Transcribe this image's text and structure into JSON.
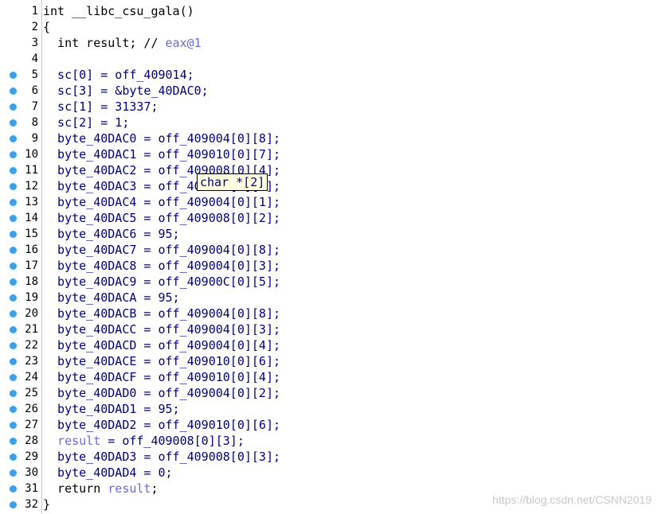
{
  "lines": [
    {
      "n": "1",
      "dot": false,
      "segs": [
        {
          "t": "int __libc_csu_gala()",
          "c": "kw"
        }
      ]
    },
    {
      "n": "2",
      "dot": false,
      "segs": [
        {
          "t": "{",
          "c": "kw"
        }
      ]
    },
    {
      "n": "3",
      "dot": false,
      "segs": [
        {
          "t": "  int result; // ",
          "c": "kw"
        },
        {
          "t": "eax@1",
          "c": "ital"
        }
      ]
    },
    {
      "n": "4",
      "dot": false,
      "segs": []
    },
    {
      "n": "5",
      "dot": true,
      "segs": [
        {
          "t": "  sc[0] = off_409014;",
          "c": "ident"
        }
      ]
    },
    {
      "n": "6",
      "dot": true,
      "segs": [
        {
          "t": "  sc[3] = &byte_40DAC0;",
          "c": "ident"
        }
      ]
    },
    {
      "n": "7",
      "dot": true,
      "segs": [
        {
          "t": "  sc[1] = 31337;",
          "c": "ident"
        }
      ]
    },
    {
      "n": "8",
      "dot": true,
      "segs": [
        {
          "t": "  sc[2] = 1;",
          "c": "ident"
        }
      ]
    },
    {
      "n": "9",
      "dot": true,
      "segs": [
        {
          "t": "  byte_40DAC0 = off_409004[0][8];",
          "c": "ident"
        }
      ]
    },
    {
      "n": "10",
      "dot": true,
      "segs": [
        {
          "t": "  byte_40DAC1 = off_409010[0][7];",
          "c": "ident"
        }
      ]
    },
    {
      "n": "11",
      "dot": true,
      "segs": [
        {
          "t": "  byte_40DAC2 = off_409008[0][4];",
          "c": "ident"
        }
      ]
    },
    {
      "n": "12",
      "dot": true,
      "segs": [
        {
          "t": "  byte_40DAC3 = off_40900C[0][6];",
          "c": "ident"
        }
      ]
    },
    {
      "n": "13",
      "dot": true,
      "segs": [
        {
          "t": "  byte_40DAC4 = off_409004[0][1];",
          "c": "ident"
        }
      ]
    },
    {
      "n": "14",
      "dot": true,
      "segs": [
        {
          "t": "  byte_40DAC5 = off_409008[0][2];",
          "c": "ident"
        }
      ]
    },
    {
      "n": "15",
      "dot": true,
      "segs": [
        {
          "t": "  byte_40DAC6 = 95;",
          "c": "ident"
        }
      ]
    },
    {
      "n": "16",
      "dot": true,
      "segs": [
        {
          "t": "  byte_40DAC7 = off_409004[0][8];",
          "c": "ident"
        }
      ]
    },
    {
      "n": "17",
      "dot": true,
      "segs": [
        {
          "t": "  byte_40DAC8 = off_409004[0][3];",
          "c": "ident"
        }
      ]
    },
    {
      "n": "18",
      "dot": true,
      "segs": [
        {
          "t": "  byte_40DAC9 = off_40900C[0][5];",
          "c": "ident"
        }
      ]
    },
    {
      "n": "19",
      "dot": true,
      "segs": [
        {
          "t": "  byte_40DACA = 95;",
          "c": "ident"
        }
      ]
    },
    {
      "n": "20",
      "dot": true,
      "segs": [
        {
          "t": "  byte_40DACB = off_409004[0][8];",
          "c": "ident"
        }
      ]
    },
    {
      "n": "21",
      "dot": true,
      "segs": [
        {
          "t": "  byte_40DACC = off_409004[0][3];",
          "c": "ident"
        }
      ]
    },
    {
      "n": "22",
      "dot": true,
      "segs": [
        {
          "t": "  byte_40DACD = off_409004[0][4];",
          "c": "ident"
        }
      ]
    },
    {
      "n": "23",
      "dot": true,
      "segs": [
        {
          "t": "  byte_40DACE = off_409010[0][6];",
          "c": "ident"
        }
      ]
    },
    {
      "n": "24",
      "dot": true,
      "segs": [
        {
          "t": "  byte_40DACF = off_409010[0][4];",
          "c": "ident"
        }
      ]
    },
    {
      "n": "25",
      "dot": true,
      "segs": [
        {
          "t": "  byte_40DAD0 = off_409004[0][2];",
          "c": "ident"
        }
      ]
    },
    {
      "n": "26",
      "dot": true,
      "segs": [
        {
          "t": "  byte_40DAD1 = 95;",
          "c": "ident"
        }
      ]
    },
    {
      "n": "27",
      "dot": true,
      "segs": [
        {
          "t": "  byte_40DAD2 = off_409010[0][6];",
          "c": "ident"
        }
      ]
    },
    {
      "n": "28",
      "dot": true,
      "segs": [
        {
          "t": "  ",
          "c": "ident"
        },
        {
          "t": "result",
          "c": "ital"
        },
        {
          "t": " = off_409008[0][3];",
          "c": "ident"
        }
      ]
    },
    {
      "n": "29",
      "dot": true,
      "segs": [
        {
          "t": "  byte_40DAD3 = off_409008[0][3];",
          "c": "ident"
        }
      ]
    },
    {
      "n": "30",
      "dot": true,
      "segs": [
        {
          "t": "  byte_40DAD4 = 0;",
          "c": "ident"
        }
      ]
    },
    {
      "n": "31",
      "dot": true,
      "segs": [
        {
          "t": "  return ",
          "c": "kw"
        },
        {
          "t": "result",
          "c": "ital"
        },
        {
          "t": ";",
          "c": "kw"
        }
      ]
    },
    {
      "n": "32",
      "dot": true,
      "segs": [
        {
          "t": "}",
          "c": "kw"
        }
      ]
    }
  ],
  "tooltip": {
    "text": "char *[2]"
  },
  "watermark": {
    "text": "https://blog.csdn.net/CSNN2019"
  },
  "colors": {
    "breakpoint_dot": "#3aa0e8",
    "identifier": "#00007f",
    "italic_var": "#6a6ad8",
    "tooltip_bg": "#ffffe1"
  }
}
